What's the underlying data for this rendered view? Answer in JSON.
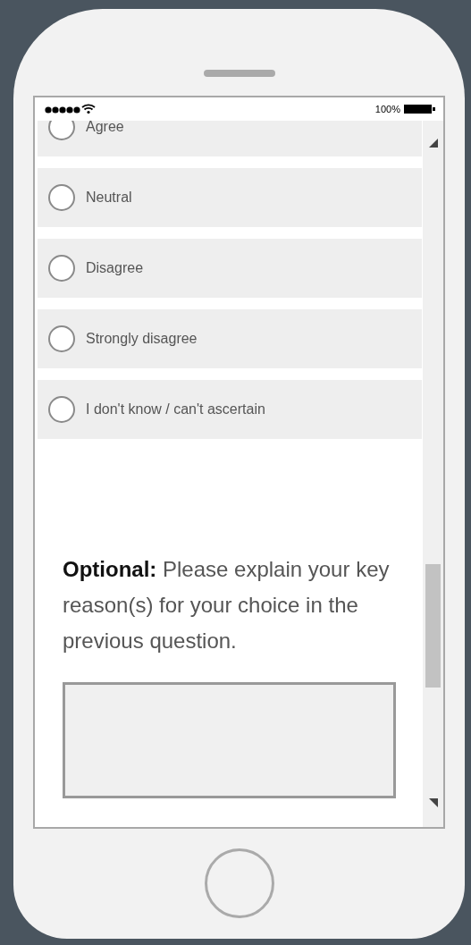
{
  "status_bar": {
    "battery_text": "100%"
  },
  "options": [
    {
      "label": "Agree",
      "selected": false
    },
    {
      "label": "Neutral",
      "selected": false
    },
    {
      "label": "Disagree",
      "selected": false
    },
    {
      "label": "Strongly disagree",
      "selected": false
    },
    {
      "label": "I don't know / can't ascertain",
      "selected": false
    }
  ],
  "question": {
    "text": "**Optional:** Please explain your key reason(s) for your choice in the previous question."
  }
}
